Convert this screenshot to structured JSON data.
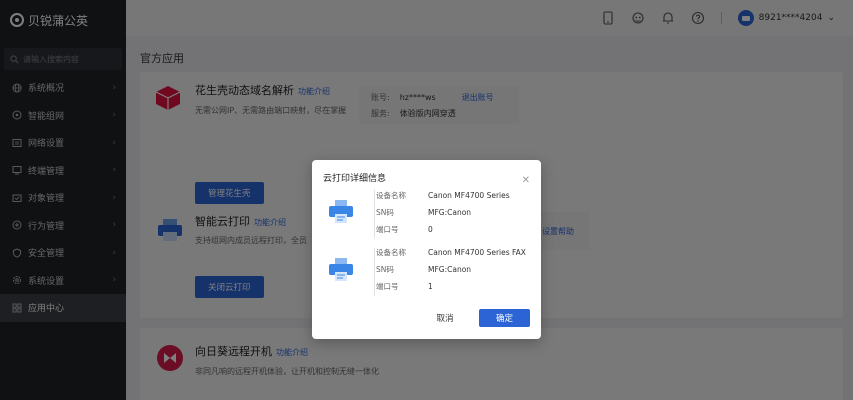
{
  "brand": {
    "name": "贝锐蒲公英"
  },
  "search": {
    "placeholder": "请输入搜索内容"
  },
  "sidebar": {
    "items": [
      {
        "label": "系统概况",
        "icon": "globe-icon"
      },
      {
        "label": "智能组网",
        "icon": "network-icon"
      },
      {
        "label": "网络设置",
        "icon": "settings-icon"
      },
      {
        "label": "终端管理",
        "icon": "terminal-icon"
      },
      {
        "label": "对象管理",
        "icon": "object-icon"
      },
      {
        "label": "行为管理",
        "icon": "behavior-icon"
      },
      {
        "label": "安全管理",
        "icon": "shield-icon"
      },
      {
        "label": "系统设置",
        "icon": "gear-icon"
      },
      {
        "label": "应用中心",
        "icon": "grid-icon"
      }
    ],
    "active_index": 8
  },
  "header": {
    "user": "8921****4204"
  },
  "main": {
    "title": "官方应用",
    "apps": [
      {
        "name": "花生壳动态域名解析",
        "link": "功能介绍",
        "desc": "无需公网IP、无需路由端口映射，尽在掌握",
        "button": "管理花生壳",
        "info": {
          "account_label": "账号:",
          "account_value": "hz****ws",
          "logout": "退出账号",
          "service_label": "服务:",
          "service_value": "体验版内网穿透"
        }
      },
      {
        "name": "智能云打印",
        "link": "功能介绍",
        "desc": "支持组网内成员远程打印，全员",
        "button": "关闭云打印",
        "right_link": "设置帮助"
      },
      {
        "name": "向日葵远程开机",
        "link": "功能介绍",
        "desc": "非同凡响的远程开机体验，让开机和控制无缝一体化"
      }
    ]
  },
  "dialog": {
    "title": "云打印详细信息",
    "printers": [
      {
        "fields": [
          {
            "k": "设备名称",
            "v": "Canon MF4700 Series"
          },
          {
            "k": "SN码",
            "v": "MFG:Canon"
          },
          {
            "k": "端口号",
            "v": "0"
          }
        ]
      },
      {
        "fields": [
          {
            "k": "设备名称",
            "v": "Canon MF4700 Series FAX"
          },
          {
            "k": "SN码",
            "v": "MFG:Canon"
          },
          {
            "k": "端口号",
            "v": "1"
          }
        ]
      }
    ],
    "cancel": "取消",
    "confirm": "确定"
  },
  "colors": {
    "accent": "#2c64d6",
    "sidebar_bg": "#1f2227",
    "app1_icon": "#e0123f",
    "app3_icon": "#d81b4d"
  }
}
